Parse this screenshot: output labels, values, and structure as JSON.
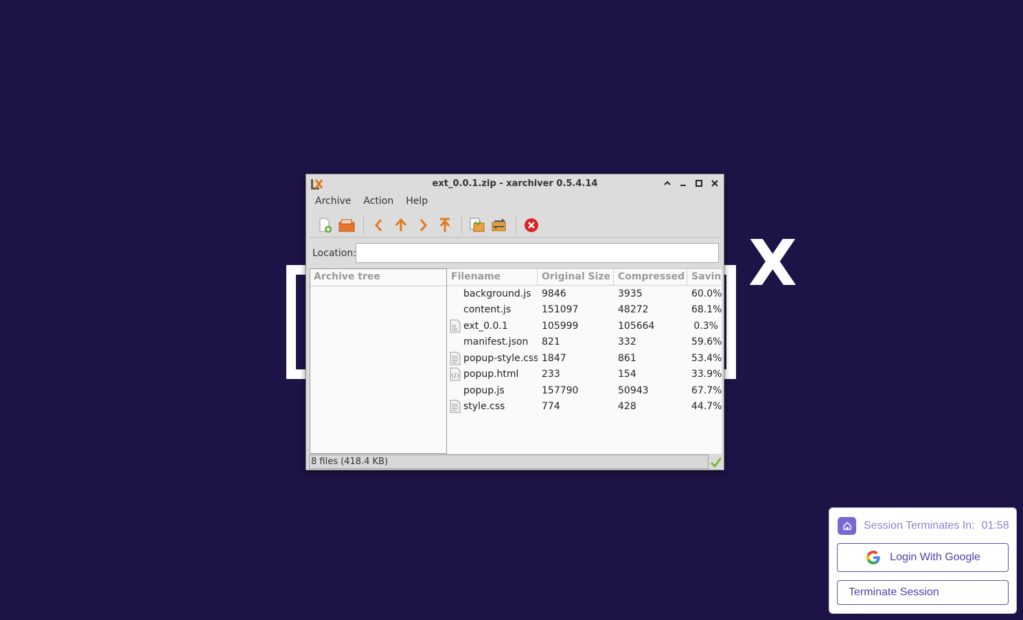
{
  "window": {
    "title": "ext_0.0.1.zip - xarchiver 0.5.4.14"
  },
  "menubar": {
    "items": [
      {
        "label": "Archive"
      },
      {
        "label": "Action"
      },
      {
        "label": "Help"
      }
    ]
  },
  "toolbar": {
    "buttons": [
      "new-archive",
      "open-archive",
      "back",
      "up",
      "forward",
      "home",
      "extract",
      "convert",
      "stop"
    ]
  },
  "location": {
    "label": "Location:",
    "value": ""
  },
  "tree": {
    "header": "Archive tree"
  },
  "files": {
    "columns": [
      "Filename",
      "Original Size",
      "Compressed",
      "Savin"
    ],
    "rows": [
      {
        "name": "background.js",
        "original": "9846",
        "compressed": "3935",
        "saving": "60.0%",
        "icon": "none"
      },
      {
        "name": "content.js",
        "original": "151097",
        "compressed": "48272",
        "saving": "68.1%",
        "icon": "none"
      },
      {
        "name": "ext_0.0.1",
        "original": "105999",
        "compressed": "105664",
        "saving": "0.3%",
        "icon": "binary-file-icon"
      },
      {
        "name": "manifest.json",
        "original": "821",
        "compressed": "332",
        "saving": "59.6%",
        "icon": "none"
      },
      {
        "name": "popup-style.css",
        "original": "1847",
        "compressed": "861",
        "saving": "53.4%",
        "icon": "text-file-icon"
      },
      {
        "name": "popup.html",
        "original": "233",
        "compressed": "154",
        "saving": "33.9%",
        "icon": "html-file-icon"
      },
      {
        "name": "popup.js",
        "original": "157790",
        "compressed": "50943",
        "saving": "67.7%",
        "icon": "none"
      },
      {
        "name": "style.css",
        "original": "774",
        "compressed": "428",
        "saving": "44.7%",
        "icon": "text-file-icon"
      }
    ]
  },
  "status": {
    "text": "8 files  (418.4 KB)"
  },
  "session": {
    "label": "Session Terminates In:",
    "time": "01:58",
    "google_button": "Login With Google",
    "terminate_button": "Terminate Session"
  },
  "colors": {
    "desktop_bg": "#1d1346",
    "accent": "#7b69d3"
  }
}
